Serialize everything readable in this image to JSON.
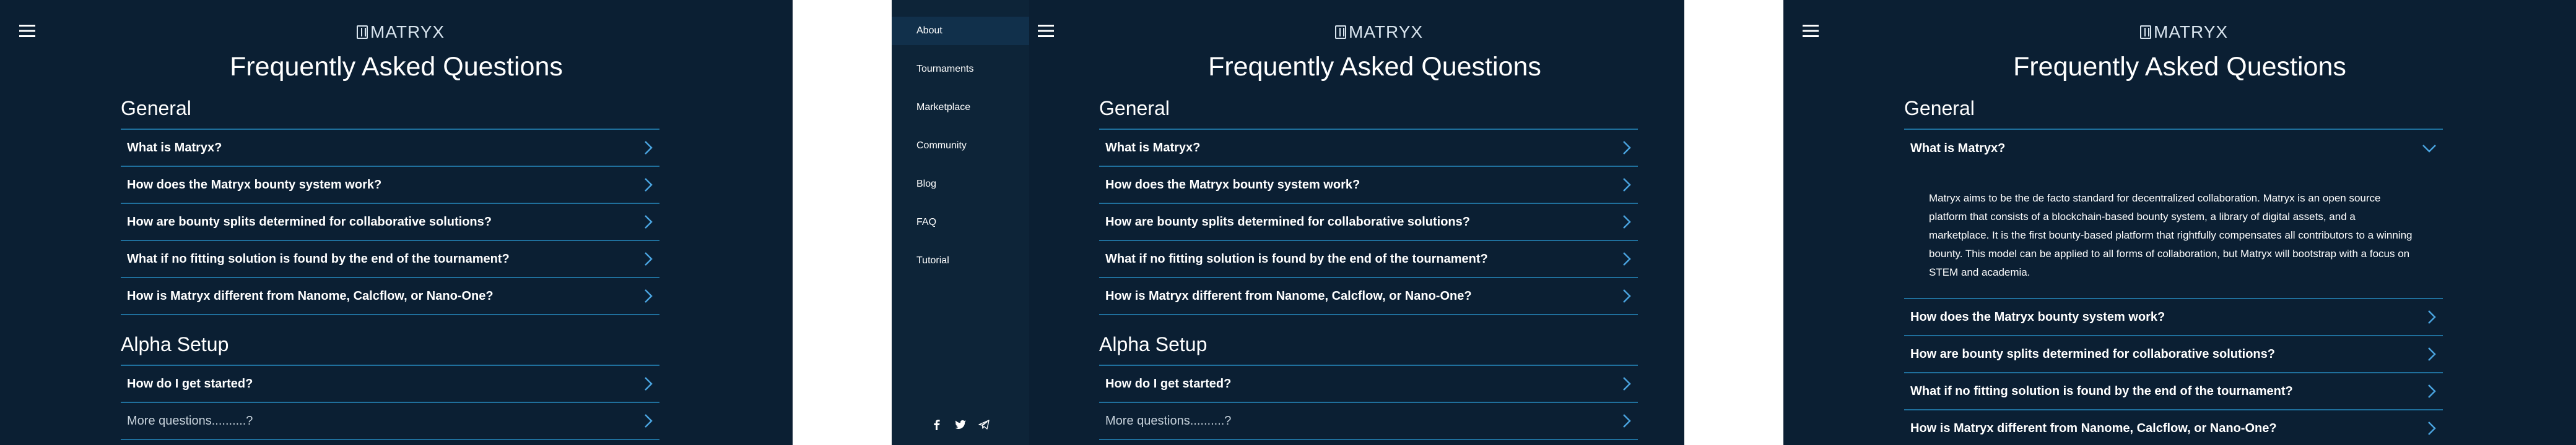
{
  "logo": {
    "text": "MATRYX"
  },
  "page_title": "Frequently Asked Questions",
  "general": {
    "title": "General",
    "questions": [
      "What is Matryx?",
      "How does the Matryx bounty system work?",
      "How are bounty splits determined for collaborative solutions?",
      "What if no fitting solution is found by the end of the tournament?",
      "How is Matryx different from Nanome, Calcflow, or Nano-One?"
    ]
  },
  "alpha": {
    "title": "Alpha Setup",
    "questions": [
      "How do I get started?",
      "More questions..........?"
    ]
  },
  "answer_what_is_matryx": "Matryx aims to be the de facto standard for decentralized collaboration. Matryx is an open source platform that consists of a blockchain-based bounty system, a library of digital assets, and a marketplace. It is the first bounty-based platform that rightfully compensates all contributors to a winning bounty. This model can be applied to all forms of collaboration, but Matryx will bootstrap with a focus on STEM and academia.",
  "nav": {
    "items": [
      "About",
      "Tournaments",
      "Marketplace",
      "Community",
      "Blog",
      "FAQ",
      "Tutorial"
    ],
    "social": [
      "facebook-icon",
      "twitter-icon",
      "telegram-icon"
    ]
  },
  "colors": {
    "background": "#0b1f33",
    "divider": "#1f6f9c",
    "accent": "#4aa3df",
    "nav_bg": "#0d2438"
  }
}
